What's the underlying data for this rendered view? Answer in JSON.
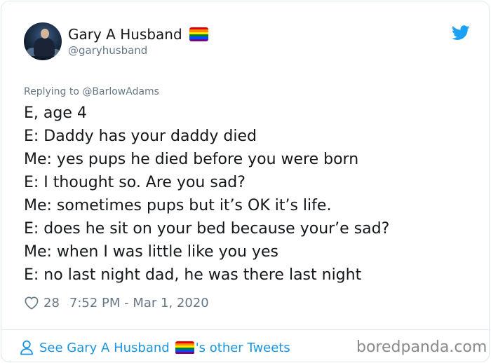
{
  "user": {
    "display_name": "Gary A Husband",
    "handle": "@garyhusband",
    "flag_icon": "rainbow-flag-icon"
  },
  "brand_icon": "twitter-bird-icon",
  "replying_to": {
    "prefix": "Replying to",
    "mention": "@BarlowAdams"
  },
  "tweet": {
    "lines": [
      "E, age 4",
      "E: Daddy has your daddy died",
      "Me: yes pups he died before you were born",
      "E: I thought so. Are you sad?",
      "Me: sometimes pups but it’s OK it’s life.",
      "E: does he sit on your bed because your’e sad?",
      "Me: when I was little like you yes",
      "E: no last night dad, he was there last night"
    ]
  },
  "meta": {
    "likes": "28",
    "timestamp": "7:52 PM - Mar 1, 2020"
  },
  "footer": {
    "see_prefix": "See Gary A Husband",
    "see_suffix": "'s other Tweets"
  },
  "watermark": "boredpanda.com",
  "colors": {
    "accent": "#1b95e0",
    "twitter_blue": "#1da1f2",
    "muted": "#657786",
    "text": "#14171a",
    "flag": [
      "#e40303",
      "#ff8c00",
      "#ffed00",
      "#008026",
      "#004dff",
      "#750787"
    ]
  }
}
